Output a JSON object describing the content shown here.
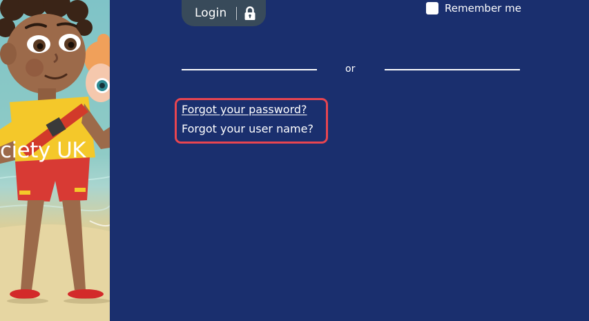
{
  "brand": {
    "text_fragment": "ciety UK"
  },
  "login": {
    "label": "Login",
    "icon": "lock-icon"
  },
  "remember": {
    "label": "Remember me",
    "checked": false
  },
  "divider": {
    "text": "or"
  },
  "forgot": {
    "password_label": "Forgot your password?",
    "username_label": "Forgot your user name?"
  },
  "colors": {
    "background": "#1a2f6e",
    "login_button": "#384a5a",
    "highlight": "#e94550",
    "text": "#ffffff"
  }
}
